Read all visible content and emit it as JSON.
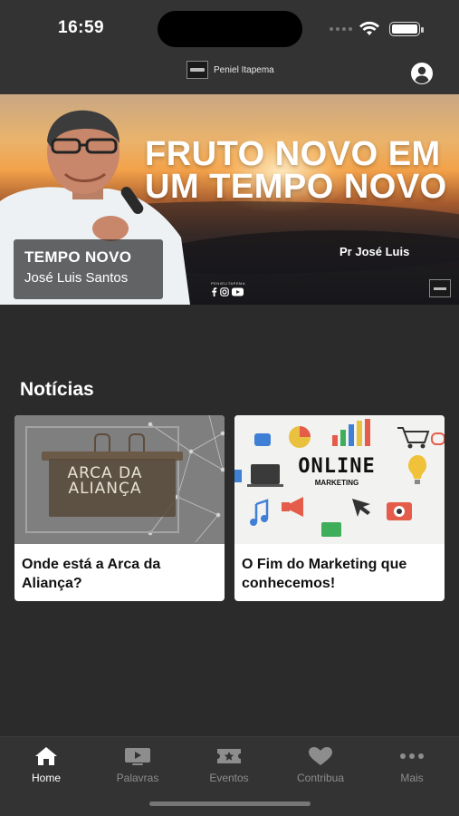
{
  "status_bar": {
    "time": "16:59"
  },
  "header": {
    "brand_name": "Peniel Itapema",
    "account_icon": "account-circle-icon"
  },
  "hero": {
    "title": "FRUTO NOVO EM UM TEMPO NOVO",
    "pastor": "Pr José Luis",
    "caption_title": "TEMPO NOVO",
    "caption_subtitle": "José Luis Santos",
    "social_label": "PENIELITAPEMA"
  },
  "news": {
    "section_title": "Notícias",
    "cards": [
      {
        "title": "Onde está a Arca da Aliança?",
        "image_text_line1": "ARCA DA",
        "image_text_line2": "ALIANÇA"
      },
      {
        "title": "O Fim do Marketing que conhecemos!",
        "image_text_line1": "ONLINE",
        "image_text_line2": "MARKETING"
      }
    ]
  },
  "tab_bar": {
    "items": [
      {
        "label": "Home",
        "icon": "home-icon",
        "active": true
      },
      {
        "label": "Palavras",
        "icon": "video-icon",
        "active": false
      },
      {
        "label": "Eventos",
        "icon": "ticket-icon",
        "active": false
      },
      {
        "label": "Contribua",
        "icon": "heart-icon",
        "active": false
      },
      {
        "label": "Mais",
        "icon": "more-icon",
        "active": false
      }
    ]
  },
  "colors": {
    "background": "#2b2b2b",
    "bar": "#333333",
    "active_tab": "#ffffff",
    "inactive_tab": "#8d8d8d"
  }
}
